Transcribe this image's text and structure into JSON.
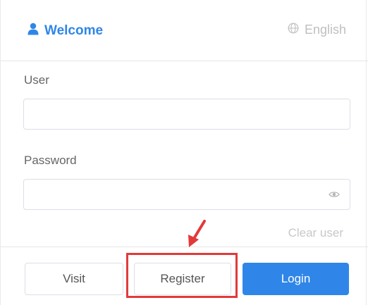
{
  "header": {
    "title": "Welcome",
    "title_icon": "user-icon",
    "language": "English",
    "language_icon": "globe-icon"
  },
  "form": {
    "user_label": "User",
    "user_value": "",
    "password_label": "Password",
    "password_value": "",
    "password_toggle_icon": "eye-icon",
    "clear_user_link": "Clear user"
  },
  "actions": {
    "visit_label": "Visit",
    "register_label": "Register",
    "login_label": "Login"
  },
  "colors": {
    "accent": "#2f86e8",
    "annotation": "#e23a3a"
  }
}
